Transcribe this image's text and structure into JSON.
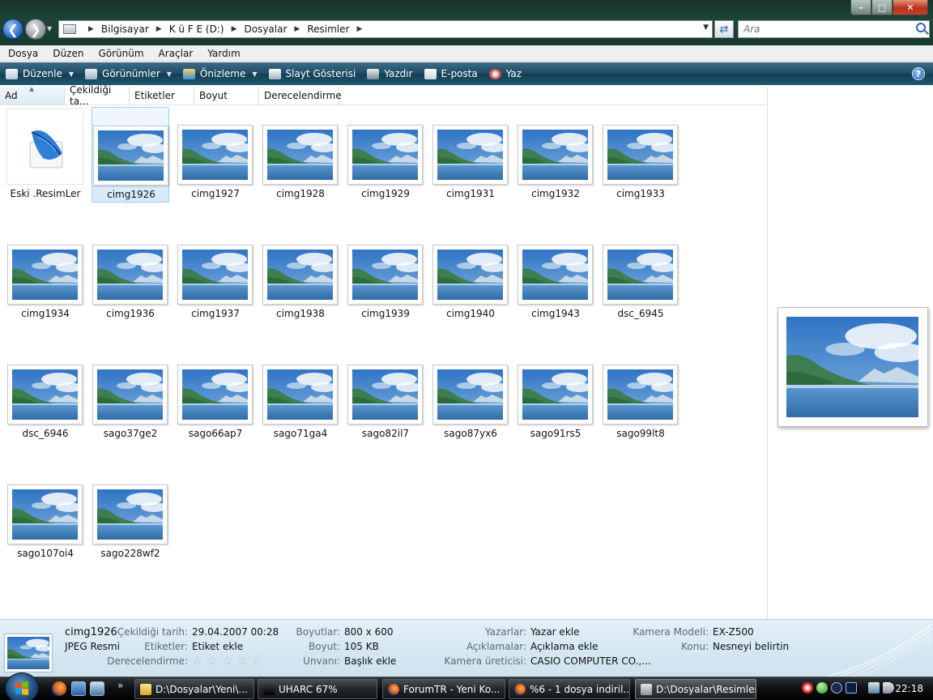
{
  "window": {
    "controls": {
      "minimize": "–",
      "maximize": "□",
      "close": "✕"
    }
  },
  "address_bar": {
    "breadcrumbs": [
      "Bilgisayar",
      "K ü F E (D:)",
      "Dosyalar",
      "Resimler"
    ],
    "search_placeholder": "Ara"
  },
  "menu": [
    "Dosya",
    "Düzen",
    "Görünüm",
    "Araçlar",
    "Yardım"
  ],
  "toolbar": {
    "organize": "Düzenle",
    "views": "Görünümler",
    "preview": "Önizleme",
    "slideshow": "Slayt Gösterisi",
    "print": "Yazdır",
    "email": "E-posta",
    "burn": "Yaz",
    "help": "?"
  },
  "columns": [
    "Ad",
    "Çekildiği ta...",
    "Etiketler",
    "Boyut",
    "Derecelendirme"
  ],
  "files": [
    {
      "name": "Eski .ResimLer",
      "type": "folder"
    },
    {
      "name": "cimg1926",
      "type": "image",
      "selected": true
    },
    {
      "name": "cimg1927",
      "type": "image"
    },
    {
      "name": "cimg1928",
      "type": "image"
    },
    {
      "name": "cimg1929",
      "type": "image"
    },
    {
      "name": "cimg1931",
      "type": "image"
    },
    {
      "name": "cimg1932",
      "type": "image"
    },
    {
      "name": "cimg1933",
      "type": "image"
    },
    {
      "name": "cimg1934",
      "type": "image"
    },
    {
      "name": "cimg1936",
      "type": "image"
    },
    {
      "name": "cimg1937",
      "type": "image"
    },
    {
      "name": "cimg1938",
      "type": "image"
    },
    {
      "name": "cimg1939",
      "type": "image"
    },
    {
      "name": "cimg1940",
      "type": "image"
    },
    {
      "name": "cimg1943",
      "type": "image"
    },
    {
      "name": "dsc_6945",
      "type": "image"
    },
    {
      "name": "dsc_6946",
      "type": "image"
    },
    {
      "name": "sago37ge2",
      "type": "image"
    },
    {
      "name": "sago66ap7",
      "type": "image"
    },
    {
      "name": "sago71ga4",
      "type": "image"
    },
    {
      "name": "sago82il7",
      "type": "image"
    },
    {
      "name": "sago87yx6",
      "type": "image"
    },
    {
      "name": "sago91rs5",
      "type": "image"
    },
    {
      "name": "sago99lt8",
      "type": "image"
    },
    {
      "name": "sago107oi4",
      "type": "image"
    },
    {
      "name": "sago228wf2",
      "type": "image"
    }
  ],
  "details": {
    "filename": "cimg1926",
    "filetype": "JPEG Resmi",
    "date_taken_label": "Çekildiği tarih:",
    "date_taken": "29.04.2007 00:28",
    "tags_label": "Etiketler:",
    "tags": "Etiket ekle",
    "rating_label": "Derecelendirme:",
    "rating": 0,
    "dimensions_label": "Boyutlar:",
    "dimensions": "800 x 600",
    "size_label": "Boyut:",
    "size": "105 KB",
    "title_label": "Unvanı:",
    "title": "Başlık ekle",
    "authors_label": "Yazarlar:",
    "authors": "Yazar ekle",
    "comments_label": "Açıklamalar:",
    "comments": "Açıklama ekle",
    "camera_maker_label": "Kamera üreticisi:",
    "camera_maker": "CASIO COMPUTER CO.,...",
    "camera_model_label": "Kamera Modeli:",
    "camera_model": "EX-Z500",
    "subject_label": "Konu:",
    "subject": "Nesneyi belirtin"
  },
  "taskbar": {
    "more": "»",
    "tasks": [
      {
        "label": "D:\\Dosyalar\\Yeni\\...",
        "icon": "folder-icon"
      },
      {
        "label": "UHARC   67%",
        "icon": "console-icon"
      },
      {
        "label": "ForumTR - Yeni Ko...",
        "icon": "firefox-icon"
      },
      {
        "label": "%6 - 1 dosya indiril...",
        "icon": "firefox-icon"
      },
      {
        "label": "D:\\Dosyalar\\Resimler",
        "icon": "camera-icon",
        "active": true
      }
    ],
    "clock": "22:18"
  },
  "colors": {
    "toolbar_bg": "#1e4a64",
    "details_bg": "#d4e7f1",
    "selection": "#d6eafb",
    "sky": "#7fb0de",
    "water": "#2f6ca8",
    "hills": "#3d7d4e"
  }
}
